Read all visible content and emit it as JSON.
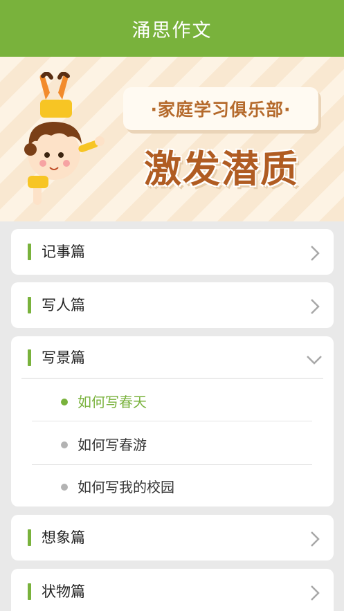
{
  "header": {
    "title": "涌思作文"
  },
  "banner": {
    "club": "·家庭学习俱乐部·",
    "slogan": "激发潜质"
  },
  "categories": [
    {
      "label": "记事篇",
      "expanded": false
    },
    {
      "label": "写人篇",
      "expanded": false
    },
    {
      "label": "写景篇",
      "expanded": true,
      "items": [
        {
          "label": "如何写春天",
          "active": true
        },
        {
          "label": "如何写春游",
          "active": false
        },
        {
          "label": "如何写我的校园",
          "active": false
        }
      ]
    },
    {
      "label": "想象篇",
      "expanded": false
    },
    {
      "label": "状物篇",
      "expanded": false
    }
  ],
  "colors": {
    "accent": "#79b23c",
    "banner_text": "#b05c22"
  },
  "icons": {
    "collapsed": "chevron-right-icon",
    "expanded": "chevron-down-icon",
    "bullet": "dot-icon"
  }
}
